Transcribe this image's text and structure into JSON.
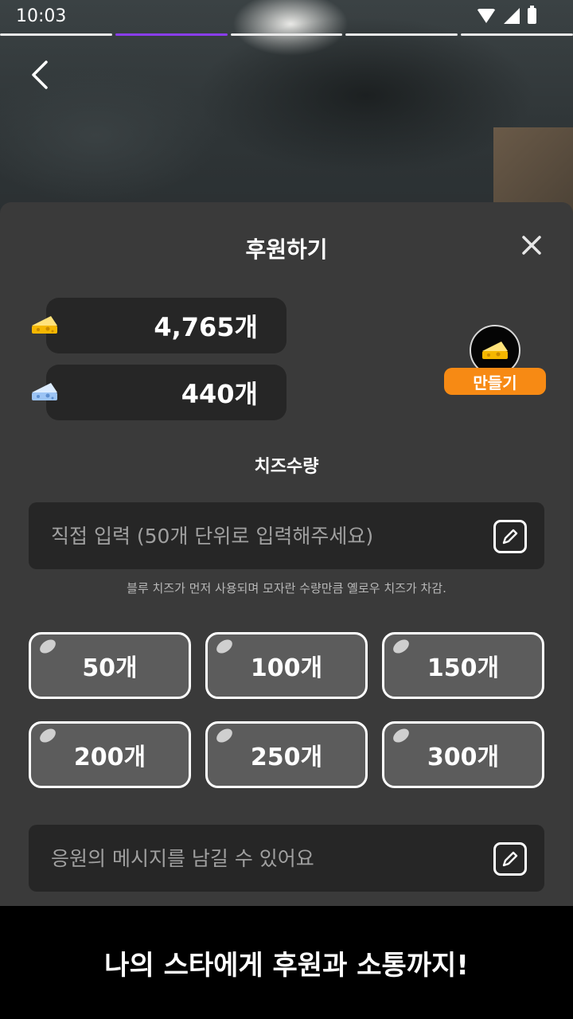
{
  "status_bar": {
    "time": "10:03"
  },
  "story_progress": {
    "segments": 5,
    "active_index": 1
  },
  "sheet": {
    "title": "후원하기",
    "balances": [
      {
        "type": "yellow-cheese-icon",
        "amount": "4,765개"
      },
      {
        "type": "blue-cheese-icon",
        "amount": "440개"
      }
    ],
    "make_button_label": "만들기",
    "quantity_label": "치즈수량",
    "direct_input_placeholder": "직접 입력 (50개 단위로 입력해주세요)",
    "hint": "블루 치즈가 먼저 사용되며 모자란 수량만큼 옐로우 치즈가 차감.",
    "amount_options": [
      "50개",
      "100개",
      "150개",
      "200개",
      "250개",
      "300개"
    ],
    "message_placeholder": "응원의 메시지를 남길 수 있어요"
  },
  "banner": {
    "text": "나의 스타에게 후원과 소통까지!"
  },
  "colors": {
    "accent_purple": "#8a3df0",
    "make_orange": "#f78a14",
    "sheet_bg": "#3a3a3a",
    "field_bg": "#262626"
  }
}
